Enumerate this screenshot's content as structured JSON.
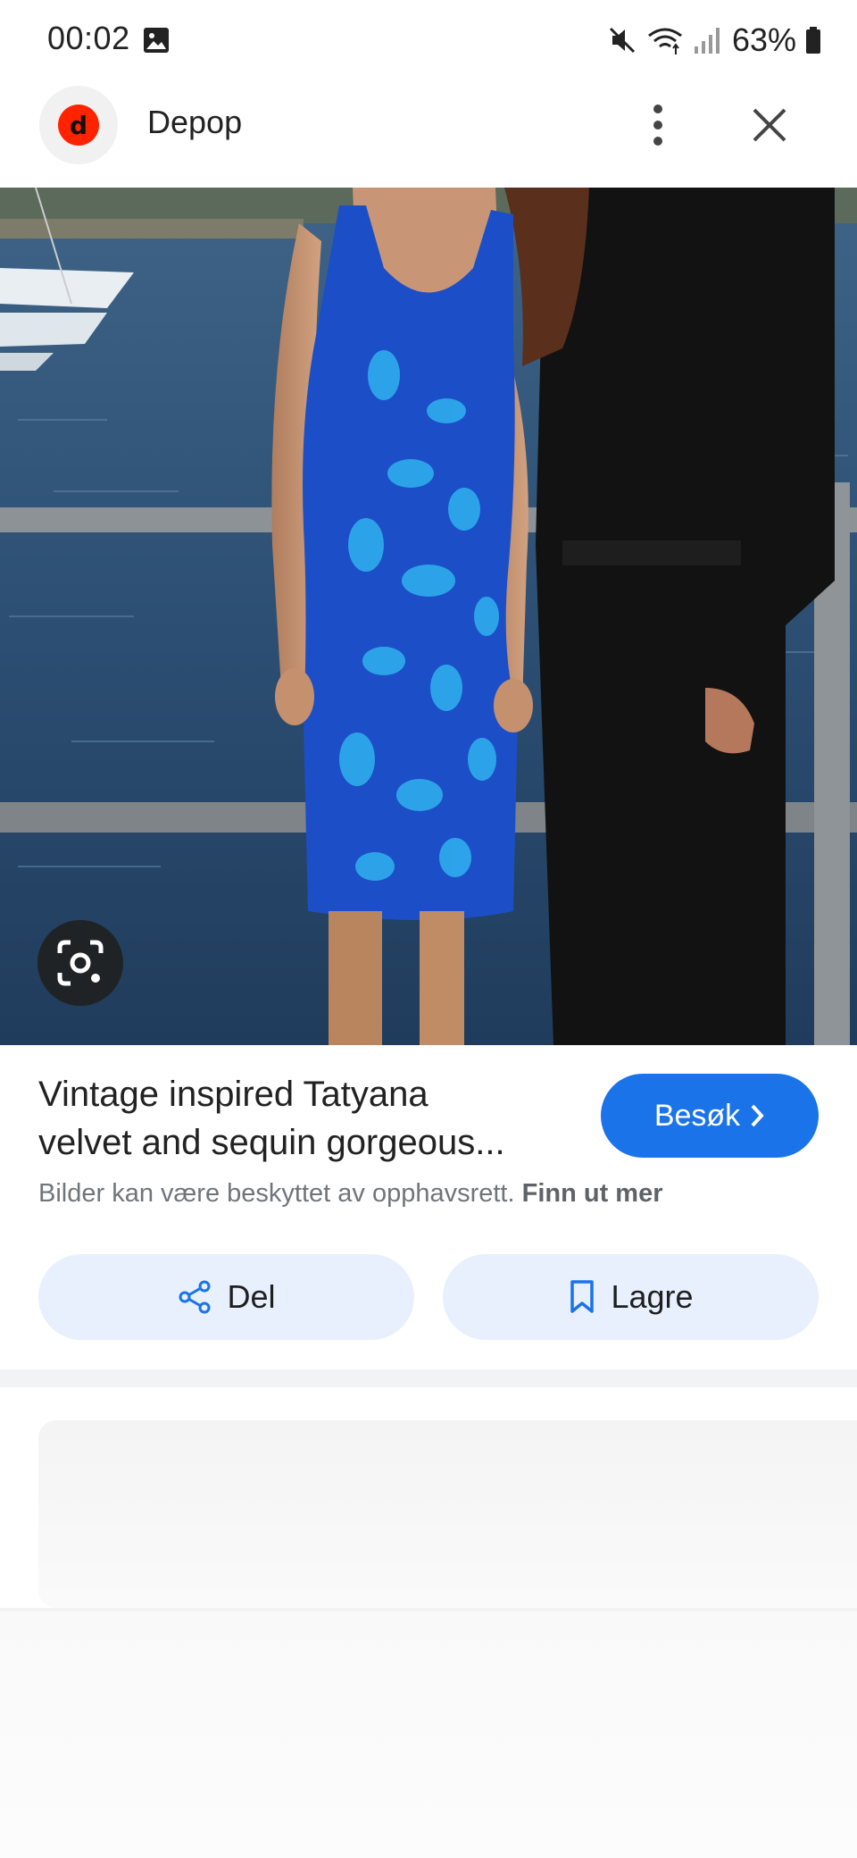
{
  "status_bar": {
    "time": "00:02",
    "battery": "63%",
    "icons": [
      "gallery-icon",
      "mute-icon",
      "wifi-icon",
      "signal-icon",
      "battery-icon"
    ]
  },
  "header": {
    "logo_letter": "d",
    "site_name": "Depop",
    "icons": [
      "more-vert-icon",
      "close-icon"
    ]
  },
  "image": {
    "lens_icon": "google-lens-icon"
  },
  "result": {
    "title_line1": "Vintage inspired Tatyana",
    "title_line2": "velvet and sequin gorgeous...",
    "visit_label": "Besøk",
    "copyright_text": "Bilder kan være beskyttet av opphavsrett.",
    "learn_more": "Finn ut mer"
  },
  "actions": {
    "share_label": "Del",
    "save_label": "Lagre"
  },
  "colors": {
    "accent": "#1a73e8",
    "chip_bg": "#e8f0fe",
    "logo_red": "#ff2300"
  }
}
